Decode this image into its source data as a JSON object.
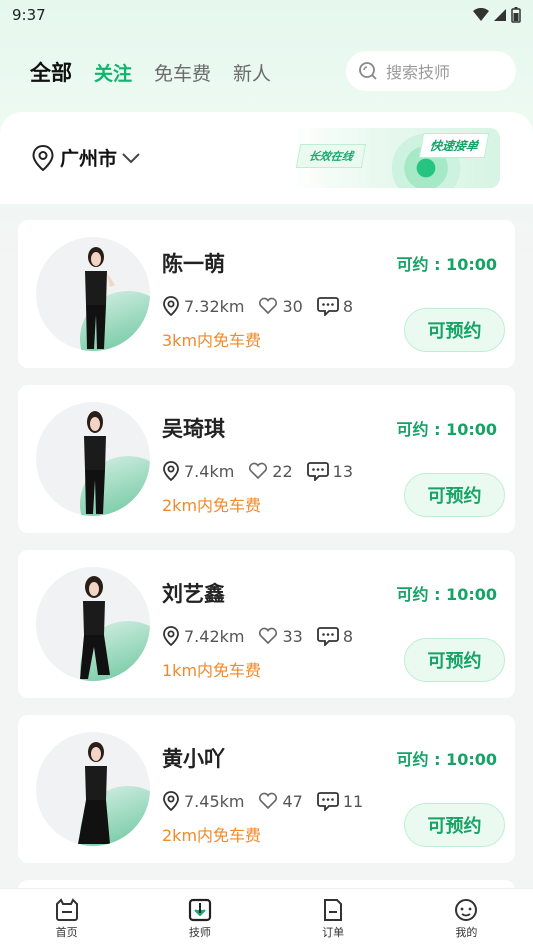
{
  "status_bar": {
    "time": "9:37"
  },
  "tabs": [
    {
      "label": "全部",
      "state": "active"
    },
    {
      "label": "关注",
      "state": "highlight"
    },
    {
      "label": "免车费",
      "state": "normal"
    },
    {
      "label": "新人",
      "state": "normal"
    }
  ],
  "search": {
    "placeholder": "搜索技师"
  },
  "location": {
    "city": "广州市"
  },
  "banner": {
    "tag_left": "长效在线",
    "tag_right": "快速接单"
  },
  "technicians": [
    {
      "name": "陈一萌",
      "available": "可约 : 10:00",
      "distance": "7.32km",
      "likes": "30",
      "comments": "8",
      "free_ride": "3km内免车费",
      "book_label": "可预约"
    },
    {
      "name": "吴琦琪",
      "available": "可约 : 10:00",
      "distance": "7.4km",
      "likes": "22",
      "comments": "13",
      "free_ride": "2km内免车费",
      "book_label": "可预约"
    },
    {
      "name": "刘艺鑫",
      "available": "可约 : 10:00",
      "distance": "7.42km",
      "likes": "33",
      "comments": "8",
      "free_ride": "1km内免车费",
      "book_label": "可预约"
    },
    {
      "name": "黄小吖",
      "available": "可约 : 10:00",
      "distance": "7.45km",
      "likes": "47",
      "comments": "11",
      "free_ride": "2km内免车费",
      "book_label": "可预约"
    }
  ],
  "bottom_nav": [
    {
      "label": "首页",
      "icon": "home-icon"
    },
    {
      "label": "技师",
      "icon": "technician-icon"
    },
    {
      "label": "订单",
      "icon": "order-icon"
    },
    {
      "label": "我的",
      "icon": "profile-icon"
    }
  ],
  "colors": {
    "accent": "#16a366",
    "orange": "#f08a2a"
  }
}
